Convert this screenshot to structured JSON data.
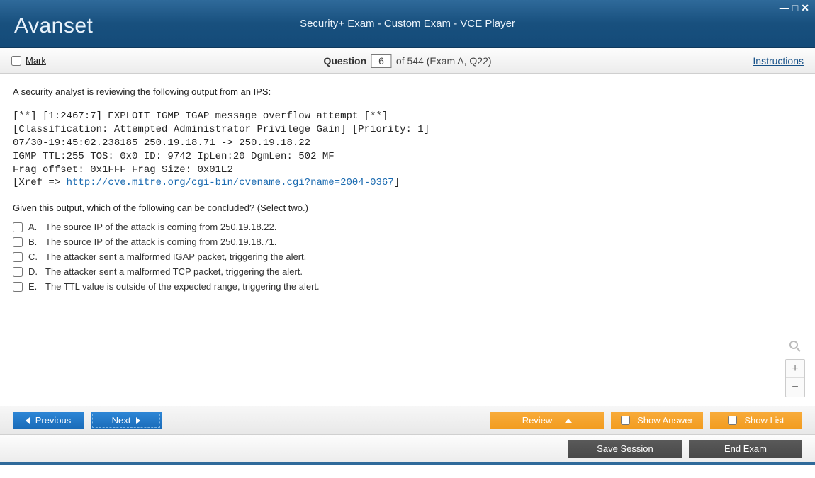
{
  "window": {
    "brand": "Avanset",
    "title": "Security+ Exam - Custom Exam - VCE Player"
  },
  "infobar": {
    "mark_label": "Mark",
    "question_label": "Question",
    "question_num": "6",
    "question_total": "of 544 (Exam A, Q22)",
    "instructions": "Instructions"
  },
  "question": {
    "intro": "A security analyst is reviewing the following output from an IPS:",
    "code_lines": [
      "[**] [1:2467:7] EXPLOIT IGMP IGAP message overflow attempt [**]",
      "[Classification: Attempted Administrator Privilege Gain] [Priority: 1]",
      "07/30-19:45:02.238185 250.19.18.71 -> 250.19.18.22",
      "IGMP TTL:255 TOS: 0x0 ID: 9742 IpLen:20 DgmLen: 502 MF",
      "Frag offset: 0x1FFF Frag Size: 0x01E2"
    ],
    "xref_prefix": "[Xref => ",
    "xref_link": "http://cve.mitre.org/cgi-bin/cvename.cgi?name=2004-0367",
    "xref_suffix": "]",
    "prompt": "Given this output, which of the following can be concluded? (Select two.)",
    "options": [
      {
        "letter": "A.",
        "text": "The source IP of the attack is coming from 250.19.18.22."
      },
      {
        "letter": "B.",
        "text": "The source IP of the attack is coming from 250.19.18.71."
      },
      {
        "letter": "C.",
        "text": "The attacker sent a malformed IGAP packet, triggering the alert."
      },
      {
        "letter": "D.",
        "text": "The attacker sent a malformed TCP packet, triggering the alert."
      },
      {
        "letter": "E.",
        "text": "The TTL value is outside of the expected range, triggering the alert."
      }
    ]
  },
  "buttons": {
    "previous": "Previous",
    "next": "Next",
    "review": "Review",
    "show_answer": "Show Answer",
    "show_list": "Show List",
    "save_session": "Save Session",
    "end_exam": "End Exam"
  }
}
